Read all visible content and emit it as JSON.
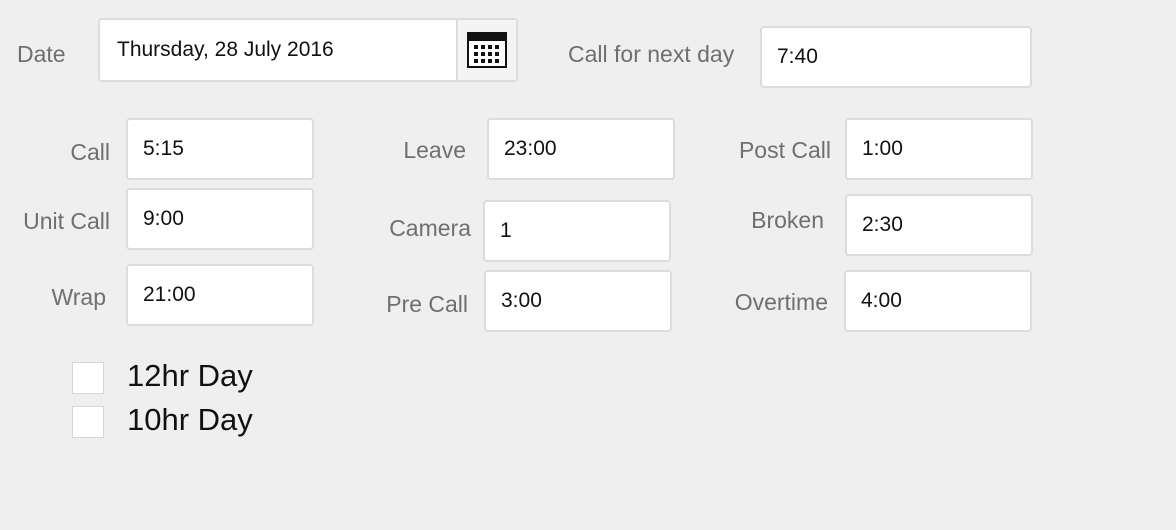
{
  "date": {
    "label": "Date",
    "value": "Thursday, 28 July 2016",
    "button_icon": "calendar-icon"
  },
  "next_day": {
    "label": "Call for next day",
    "value": "7:40"
  },
  "fields": {
    "call": {
      "label": "Call",
      "value": "5:15"
    },
    "unit_call": {
      "label": "Unit Call",
      "value": "9:00"
    },
    "wrap": {
      "label": "Wrap",
      "value": "21:00"
    },
    "leave": {
      "label": "Leave",
      "value": "23:00"
    },
    "camera": {
      "label": "Camera",
      "value": "1"
    },
    "pre_call": {
      "label": "Pre Call",
      "value": "3:00"
    },
    "post_call": {
      "label": "Post Call",
      "value": "1:00"
    },
    "broken": {
      "label": "Broken",
      "value": "2:30"
    },
    "overtime": {
      "label": "Overtime",
      "value": "4:00"
    }
  },
  "options": [
    {
      "label": "12hr Day",
      "checked": false
    },
    {
      "label": "10hr Day",
      "checked": false
    }
  ]
}
